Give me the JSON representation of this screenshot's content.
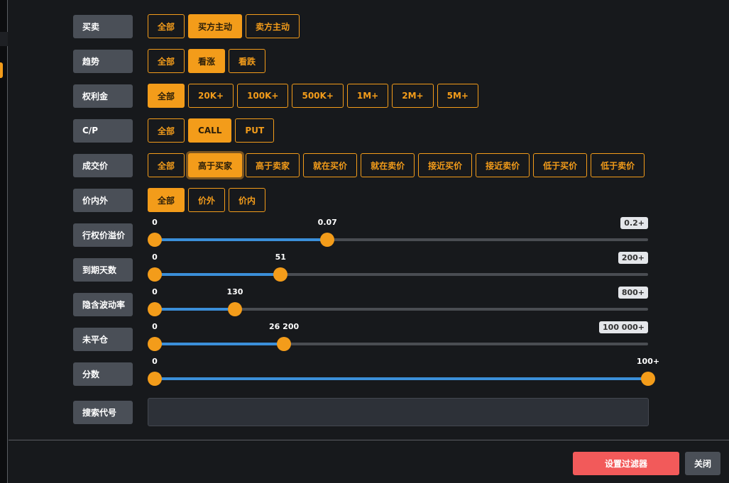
{
  "filters": [
    {
      "label": "买卖",
      "options": [
        "全部",
        "买方主动",
        "卖方主动"
      ],
      "selected": 1
    },
    {
      "label": "趋势",
      "options": [
        "全部",
        "看涨",
        "看跌"
      ],
      "selected": 1
    },
    {
      "label": "权利金",
      "options": [
        "全部",
        "20K+",
        "100K+",
        "500K+",
        "1M+",
        "2M+",
        "5M+"
      ],
      "selected": 0
    },
    {
      "label": "C/P",
      "options": [
        "全部",
        "CALL",
        "PUT"
      ],
      "selected": 1
    },
    {
      "label": "成交价",
      "options": [
        "全部",
        "高于买家",
        "高于卖家",
        "就在买价",
        "就在卖价",
        "接近买价",
        "接近卖价",
        "低于买价",
        "低于卖价"
      ],
      "selected": 1
    },
    {
      "label": "价内外",
      "options": [
        "全部",
        "价外",
        "价内"
      ],
      "selected": 0
    }
  ],
  "sliders": [
    {
      "label": "行权价溢价",
      "min_label": "0",
      "value_label": "0.07",
      "max_label": "0.2+",
      "value": 0.07,
      "max": 0.2
    },
    {
      "label": "到期天数",
      "min_label": "0",
      "value_label": "51",
      "max_label": "200+",
      "value": 51,
      "max": 200
    },
    {
      "label": "隐含波动率",
      "min_label": "0",
      "value_label": "130",
      "max_label": "800+",
      "value": 130,
      "max": 800
    },
    {
      "label": "未平仓",
      "min_label": "0",
      "value_label": "26 200",
      "max_label": "100 000+",
      "value": 26200,
      "max": 100000
    },
    {
      "label": "分数",
      "min_label": "0",
      "value_label": "100+",
      "max_label": "",
      "value": 100,
      "max": 100
    }
  ],
  "search": {
    "label": "搜索代号",
    "value": ""
  },
  "footer": {
    "apply": "设置过滤器",
    "close": "关闭"
  },
  "colors": {
    "accent": "#f39c1a",
    "fill": "#3b8fd9",
    "apply": "#f25a5a"
  }
}
